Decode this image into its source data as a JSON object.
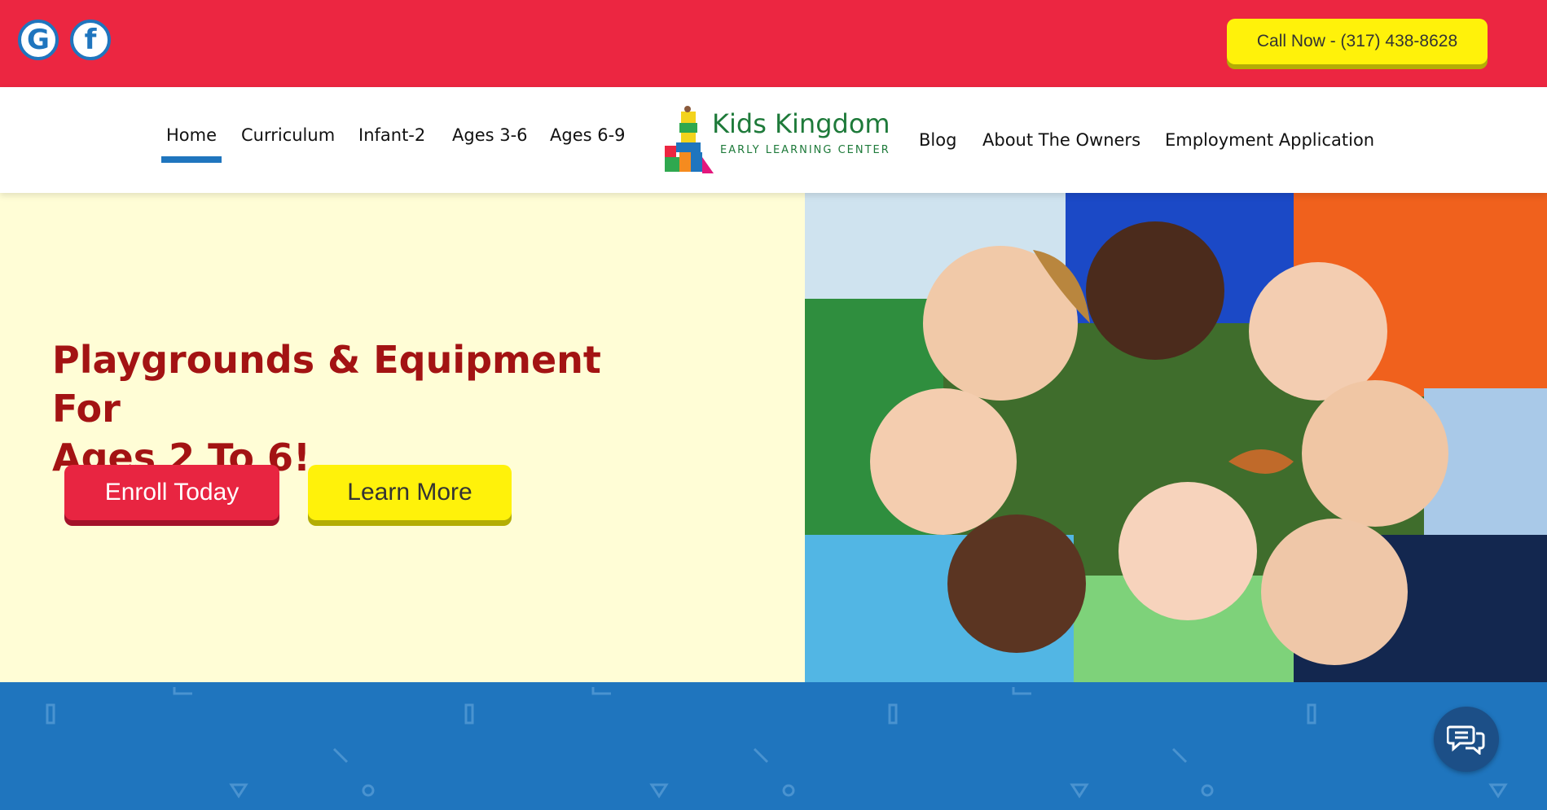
{
  "topbar": {
    "social": [
      {
        "icon": "google-icon",
        "glyph": "G"
      },
      {
        "icon": "facebook-icon",
        "glyph": "f"
      }
    ],
    "call_label": "Call Now - (317) 438-8628",
    "colors": {
      "bar": "#ec2641",
      "call_button": "#fff20a",
      "social_ring": "#1f75be"
    }
  },
  "nav": {
    "left_items": [
      "Home",
      "Curriculum",
      "Infant-2",
      "Ages 3-6",
      "Ages 6-9"
    ],
    "right_items": [
      "Blog",
      "About The Owners",
      "Employment Application"
    ],
    "active": "Home",
    "logo": {
      "title": "Kids Kingdom",
      "subtitle": "EARLY LEARNING CENTER"
    }
  },
  "hero": {
    "headline_line1": "Playgrounds & Equipment For",
    "headline_line2": "Ages 2 To 6!",
    "enroll_label": "Enroll Today",
    "learn_label": "Learn More",
    "image_alt": "children lying in a circle on grass, smiling",
    "colors": {
      "background": "#fffdd6",
      "headline": "#a31313",
      "enroll": "#e82541",
      "learn": "#fff20a"
    }
  },
  "footer_band": {
    "color": "#1f75be"
  },
  "chat": {
    "icon": "chat-bubbles-icon"
  }
}
